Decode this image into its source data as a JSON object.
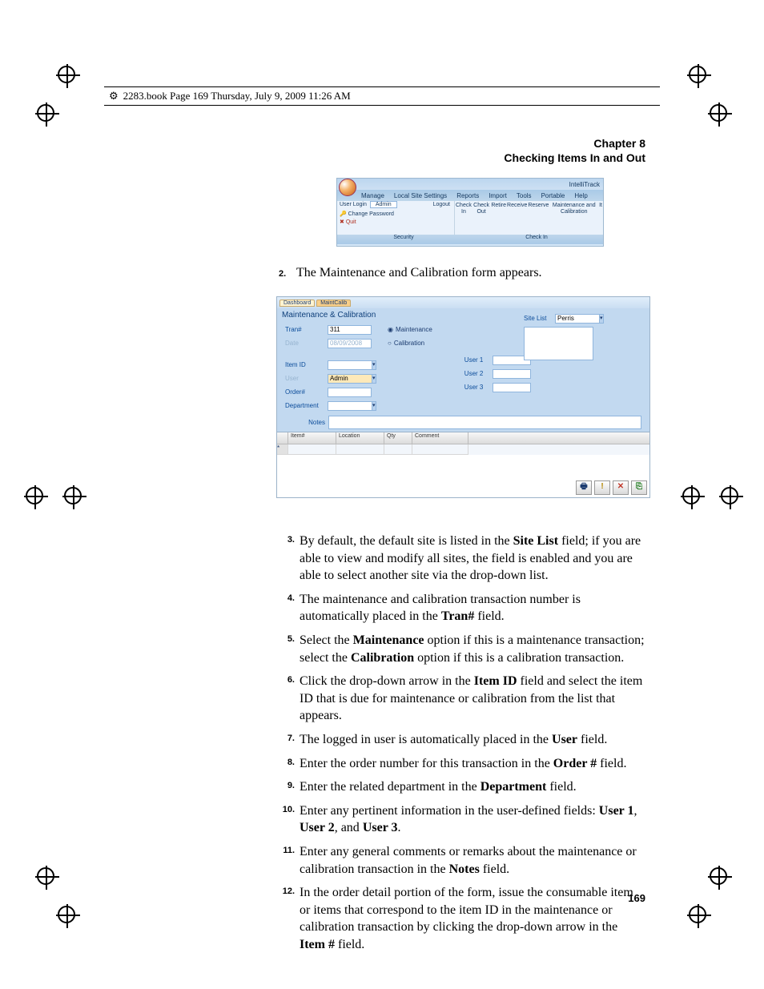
{
  "book_tag": "2283.book  Page 169  Thursday, July 9, 2009  11:26 AM",
  "header": {
    "chapter": "Chapter 8",
    "title": "Checking Items In and Out"
  },
  "ribbon": {
    "app_name": "IntelliTrack",
    "tabs": [
      "Manage",
      "Local Site Settings",
      "Reports",
      "Import",
      "Tools",
      "Portable",
      "Help"
    ],
    "user_login_label": "User Login",
    "user_login_value": "Admin",
    "logout": "Logout",
    "change_password": "Change Password",
    "quit": "Quit",
    "group_left": "Security",
    "group_right": "Check In",
    "buttons": [
      "Check In",
      "Check Out",
      "Retire",
      "Receive",
      "Reserve",
      "Maintenance and Calibration",
      "It"
    ]
  },
  "step2": {
    "num": "2.",
    "text": "The Maintenance and Calibration form appears."
  },
  "form": {
    "tabs": {
      "dashboard": "Dashboard",
      "active": "MaintCalib"
    },
    "title": "Maintenance & Calibration",
    "tran_label": "Tran#",
    "tran_value": "311",
    "date_label": "Date",
    "date_value": "08/09/2008",
    "radio_maint": "Maintenance",
    "radio_calib": "Calibration",
    "itemid_label": "Item ID",
    "user_label": "User",
    "user_value": "Admin",
    "order_label": "Order#",
    "dept_label": "Department",
    "notes_label": "Notes",
    "sitelist_label": "Site List",
    "sitelist_value": "Perris",
    "user1": "User 1",
    "user2": "User 2",
    "user3": "User 3",
    "grid_cols": {
      "c1": "",
      "c2": "Item#",
      "c3": "Location",
      "c4": "Qty",
      "c5": "Comment"
    },
    "btn_print": "🖶",
    "btn_warn": "!",
    "btn_close": "✕",
    "btn_save": "⎘"
  },
  "items": {
    "i3": {
      "n": "3.",
      "pre": "By default, the default site is listed in the ",
      "b1": "Site List",
      "post": " field; if you are able to view and modify all sites, the field is enabled and you are able to select another site via the drop-down list."
    },
    "i4": {
      "n": "4.",
      "pre": "The maintenance and calibration transaction number is automatically placed in the ",
      "b1": "Tran#",
      "post": " field."
    },
    "i5": {
      "n": "5.",
      "pre": "Select the ",
      "b1": "Maintenance",
      "mid": " option if this is a maintenance transaction; select the ",
      "b2": "Calibration",
      "post": " option if this is a calibration transaction."
    },
    "i6": {
      "n": "6.",
      "pre": "Click the drop-down arrow in the ",
      "b1": "Item ID",
      "post": " field and select the item ID that is due for maintenance or calibration from the list that appears."
    },
    "i7": {
      "n": "7.",
      "pre": "The logged in user is automatically placed in the ",
      "b1": "User",
      "post": " field."
    },
    "i8": {
      "n": "8.",
      "pre": "Enter the order number for this transaction in the ",
      "b1": "Order #",
      "post": " field."
    },
    "i9": {
      "n": "9.",
      "pre": "Enter the related department in the ",
      "b1": "Department",
      "post": " field."
    },
    "i10": {
      "n": "10.",
      "pre": "Enter any pertinent information in the user-defined fields: ",
      "b1": "User 1",
      "mid1": ", ",
      "b2": "User 2",
      "mid2": ", and ",
      "b3": "User 3",
      "post": "."
    },
    "i11": {
      "n": "11.",
      "pre": "Enter any general comments or remarks about the maintenance or calibration transaction in the ",
      "b1": "Notes",
      "post": " field."
    },
    "i12": {
      "n": "12.",
      "pre": "In the order detail portion of the form, issue the consumable item or items that correspond to the item ID in the maintenance or calibration transaction by clicking the drop-down arrow in the ",
      "b1": "Item #",
      "post": " field."
    }
  },
  "page_number": "169"
}
